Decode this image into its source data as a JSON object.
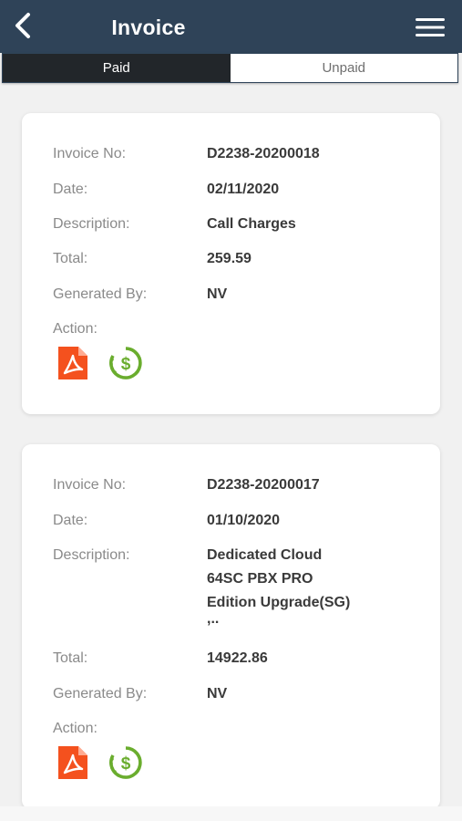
{
  "header": {
    "title": "Invoice",
    "back_icon": "chevron-left-icon",
    "menu_icon": "hamburger-menu-icon",
    "background": "#2f4358"
  },
  "tabs": [
    {
      "label": "Paid",
      "active": true
    },
    {
      "label": "Unpaid",
      "active": false
    }
  ],
  "labels": {
    "invoice_no": "Invoice No:",
    "date": "Date:",
    "description": "Description:",
    "total": "Total:",
    "generated_by": "Generated By:",
    "action": "Action:"
  },
  "invoices": [
    {
      "invoice_no": "D2238-20200018",
      "date": "02/11/2020",
      "description": [
        "Call Charges"
      ],
      "total": "259.59",
      "generated_by": "NV",
      "actions": [
        "pdf-icon",
        "payment-refresh-icon"
      ]
    },
    {
      "invoice_no": "D2238-20200017",
      "date": "01/10/2020",
      "description": [
        "Dedicated Cloud",
        "64SC PBX PRO",
        "Edition Upgrade(SG)",
        ",.."
      ],
      "total": "14922.86",
      "generated_by": "NV",
      "actions": [
        "pdf-icon",
        "payment-refresh-icon"
      ]
    }
  ],
  "colors": {
    "pdf": "#f4511e",
    "payment": "#6aad2e",
    "tab_active": "#22262a"
  }
}
